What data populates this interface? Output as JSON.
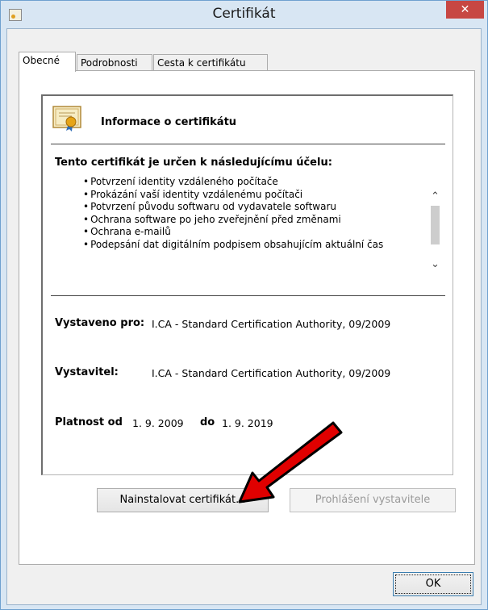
{
  "window": {
    "title": "Certifikát",
    "close_glyph": "✕"
  },
  "tabs": [
    {
      "label": "Obecné",
      "active": true
    },
    {
      "label": "Podrobnosti",
      "active": false
    },
    {
      "label": "Cesta k certifikátu",
      "active": false
    }
  ],
  "certificate": {
    "info_title": "Informace o certifikátu",
    "purpose_heading": "Tento certifikát je určen k následujícímu účelu:",
    "purposes": [
      "Potvrzení identity vzdáleného počítače",
      "Prokázání vaší identity vzdálenému počítači",
      "Potvrzení původu softwaru od vydavatele softwaru",
      "Ochrana software po jeho zveřejnění před změnami",
      "Ochrana e-mailů",
      "Podepsání dat digitálním podpisem obsahujícím aktuální čas"
    ],
    "issued_to_label": "Vystaveno pro:",
    "issued_to_value": "I.CA - Standard Certification Authority, 09/2009",
    "issuer_label": "Vystavitel:",
    "issuer_value": "I.CA - Standard Certification Authority, 09/2009",
    "valid_from_label": "Platnost od",
    "valid_from_value": "1. 9. 2009",
    "valid_to_label": "do",
    "valid_to_value": "1. 9. 2019"
  },
  "buttons": {
    "install_label": "Nainstalovat certifikát...",
    "issuer_statement_label": "Prohlášení vystavitele",
    "ok_label": "OK"
  },
  "colors": {
    "window_frame": "#d8e6f3",
    "close_button": "#c74743",
    "annotation_arrow": "#e00000"
  }
}
